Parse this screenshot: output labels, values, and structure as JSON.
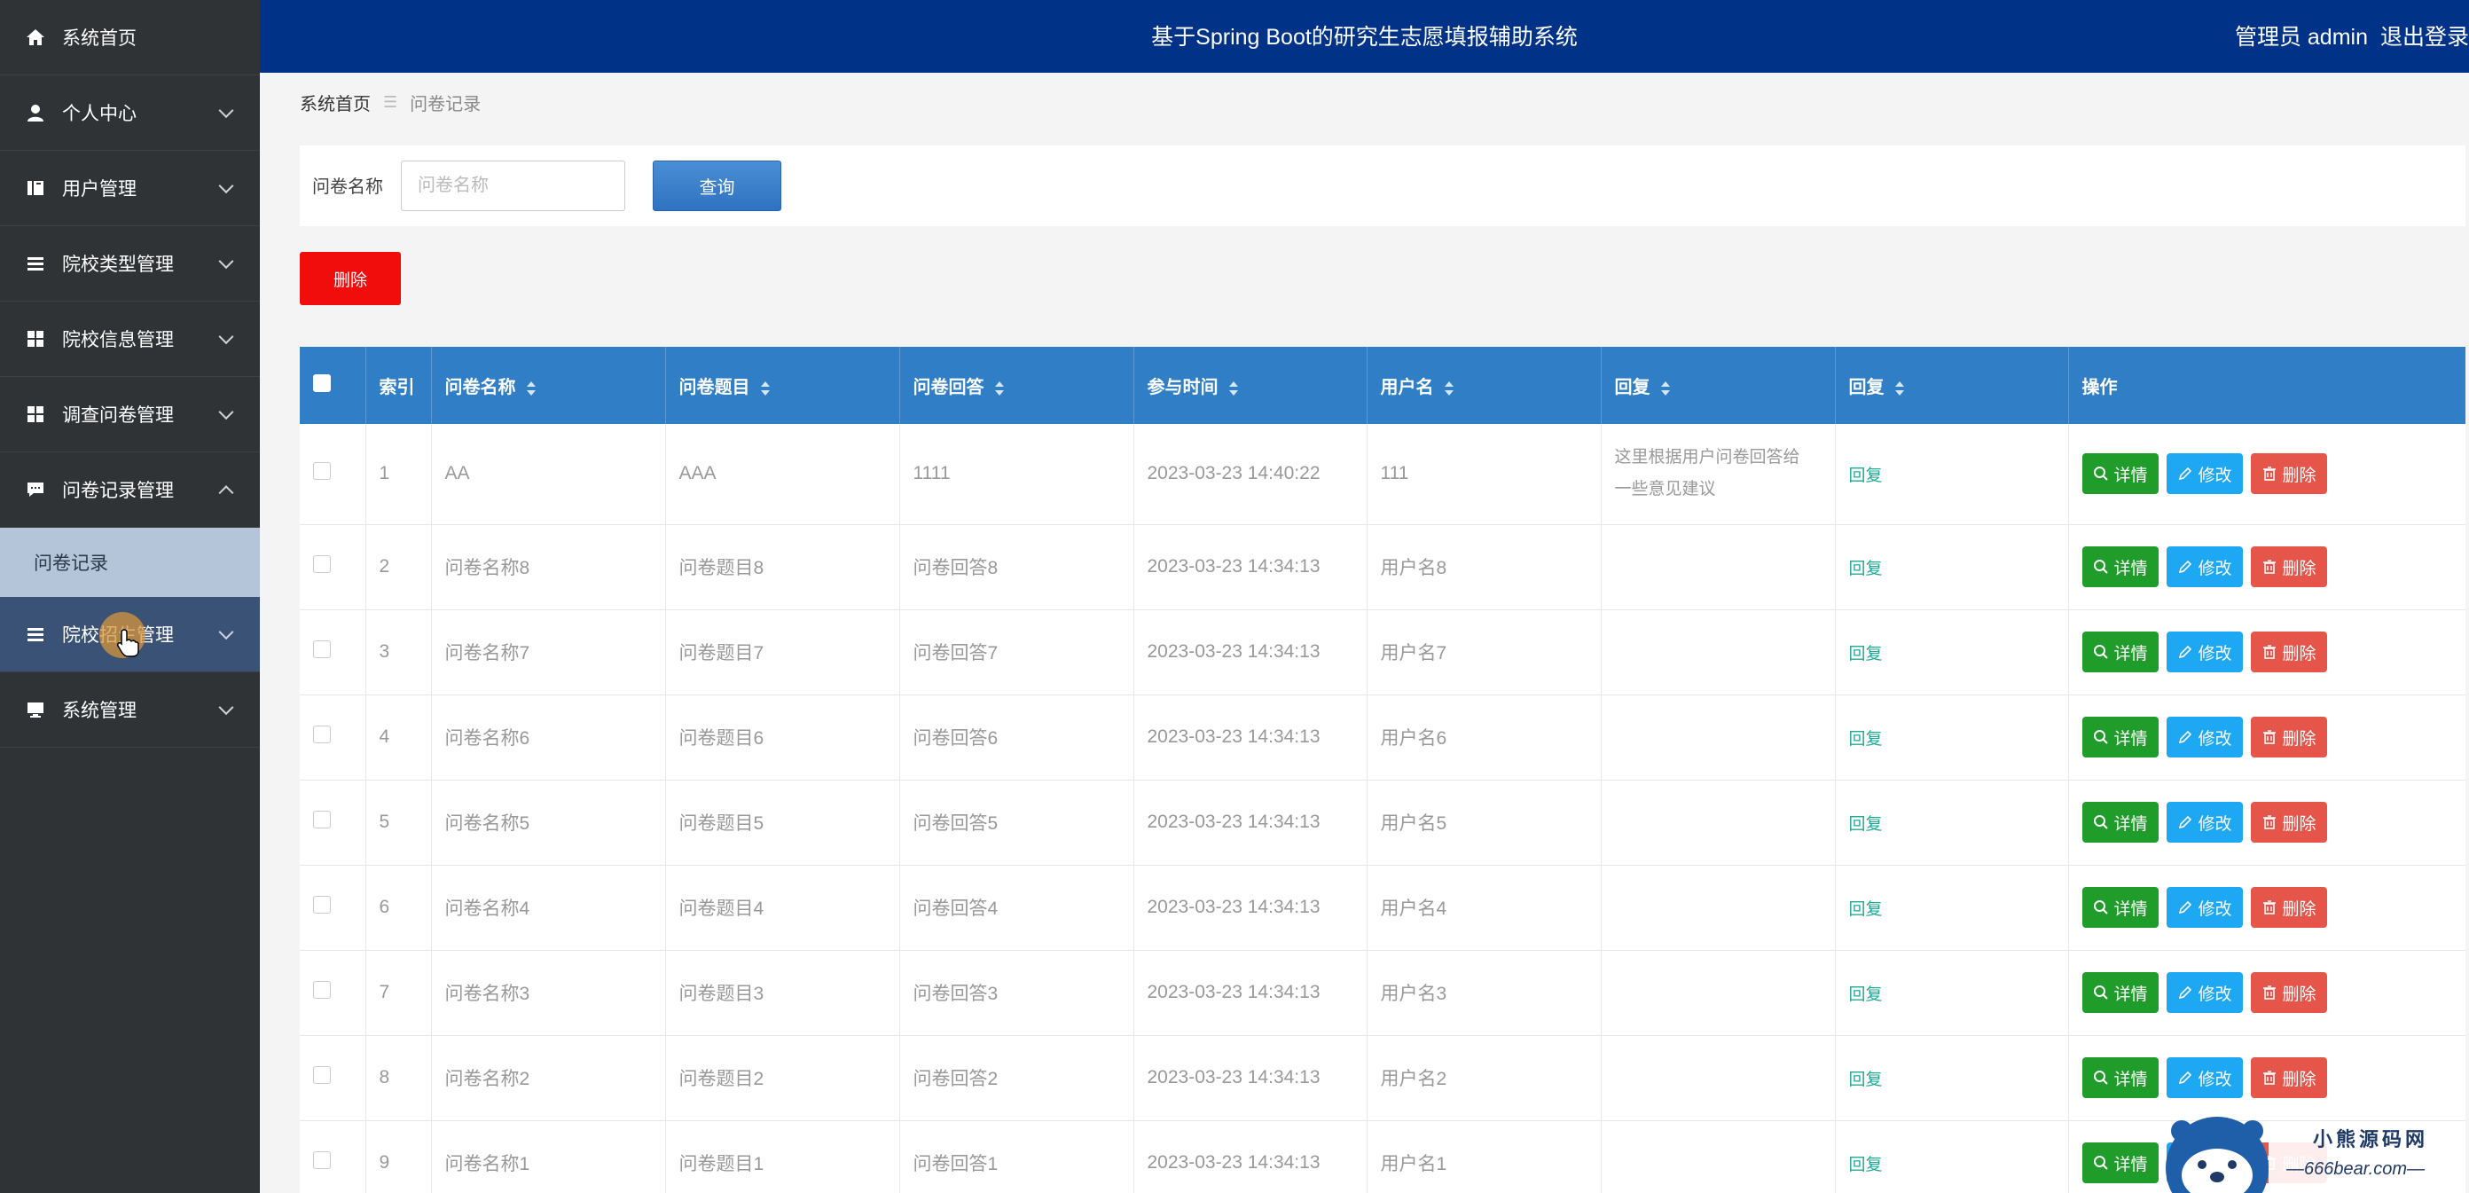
{
  "header": {
    "title": "基于Spring Boot的研究生志愿填报辅助系统",
    "user_label": "管理员 admin",
    "logout_label": "退出登录"
  },
  "sidebar": {
    "items": [
      {
        "label": "系统首页",
        "icon": "home-icon",
        "expanded": false,
        "has_chevron": false
      },
      {
        "label": "个人中心",
        "icon": "user-icon",
        "has_chevron": true
      },
      {
        "label": "用户管理",
        "icon": "book-icon",
        "has_chevron": true
      },
      {
        "label": "院校类型管理",
        "icon": "list-icon",
        "has_chevron": true
      },
      {
        "label": "院校信息管理",
        "icon": "grid-icon",
        "has_chevron": true
      },
      {
        "label": "调查问卷管理",
        "icon": "grid-icon",
        "has_chevron": true
      },
      {
        "label": "问卷记录管理",
        "icon": "chat-icon",
        "has_chevron": true,
        "expanded": true
      },
      {
        "label": "院校招生管理",
        "icon": "list-icon",
        "has_chevron": true
      },
      {
        "label": "系统管理",
        "icon": "monitor-icon",
        "has_chevron": true
      }
    ],
    "sub_item": "问卷记录"
  },
  "breadcrumb": {
    "home": "系统首页",
    "separator": "☰",
    "current": "问卷记录"
  },
  "search": {
    "label": "问卷名称",
    "placeholder": "问卷名称",
    "value": "",
    "button_label": "查询"
  },
  "toolbar": {
    "delete_label": "删除"
  },
  "table": {
    "columns": [
      "索引",
      "问卷名称",
      "问卷题目",
      "问卷回答",
      "参与时间",
      "用户名",
      "回复",
      "回复",
      "操作"
    ],
    "rows": [
      {
        "index": "1",
        "name": "AA",
        "question": "AAA",
        "answer": "1111",
        "time": "2023-03-23 14:40:22",
        "username": "111",
        "reply_text": "这里根据用户问卷回答给一些意见建议",
        "reply_link": "回复"
      },
      {
        "index": "2",
        "name": "问卷名称8",
        "question": "问卷题目8",
        "answer": "问卷回答8",
        "time": "2023-03-23 14:34:13",
        "username": "用户名8",
        "reply_text": "",
        "reply_link": "回复"
      },
      {
        "index": "3",
        "name": "问卷名称7",
        "question": "问卷题目7",
        "answer": "问卷回答7",
        "time": "2023-03-23 14:34:13",
        "username": "用户名7",
        "reply_text": "",
        "reply_link": "回复"
      },
      {
        "index": "4",
        "name": "问卷名称6",
        "question": "问卷题目6",
        "answer": "问卷回答6",
        "time": "2023-03-23 14:34:13",
        "username": "用户名6",
        "reply_text": "",
        "reply_link": "回复"
      },
      {
        "index": "5",
        "name": "问卷名称5",
        "question": "问卷题目5",
        "answer": "问卷回答5",
        "time": "2023-03-23 14:34:13",
        "username": "用户名5",
        "reply_text": "",
        "reply_link": "回复"
      },
      {
        "index": "6",
        "name": "问卷名称4",
        "question": "问卷题目4",
        "answer": "问卷回答4",
        "time": "2023-03-23 14:34:13",
        "username": "用户名4",
        "reply_text": "",
        "reply_link": "回复"
      },
      {
        "index": "7",
        "name": "问卷名称3",
        "question": "问卷题目3",
        "answer": "问卷回答3",
        "time": "2023-03-23 14:34:13",
        "username": "用户名3",
        "reply_text": "",
        "reply_link": "回复"
      },
      {
        "index": "8",
        "name": "问卷名称2",
        "question": "问卷题目2",
        "answer": "问卷回答2",
        "time": "2023-03-23 14:34:13",
        "username": "用户名2",
        "reply_text": "",
        "reply_link": "回复"
      },
      {
        "index": "9",
        "name": "问卷名称1",
        "question": "问卷题目1",
        "answer": "问卷回答1",
        "time": "2023-03-23 14:34:13",
        "username": "用户名1",
        "reply_text": "",
        "reply_link": "回复"
      }
    ],
    "actions": {
      "detail": "详情",
      "edit": "修改",
      "delete": "删除"
    }
  },
  "watermark": {
    "title": "小熊源码网",
    "url": "—666bear.com—"
  },
  "colors": {
    "header_bg": "#003288",
    "sidebar_bg": "#2f3336",
    "table_header_bg": "#2f7ec6",
    "detail_btn": "#1f9c2a",
    "edit_btn": "#1ea7f2",
    "delete_btn": "#e5554a",
    "danger": "#f20d0d"
  }
}
